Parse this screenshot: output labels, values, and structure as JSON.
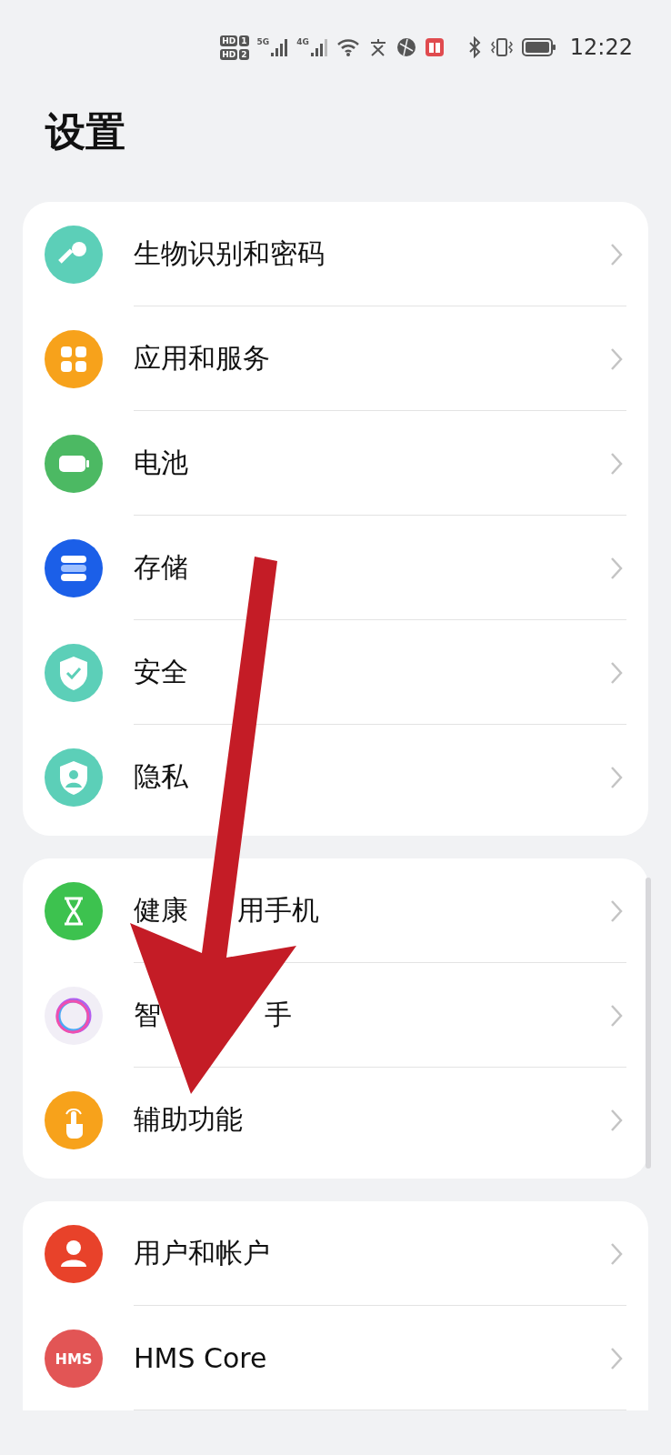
{
  "status_bar": {
    "sim_labels": [
      {
        "hd": "HD",
        "slot": "1"
      },
      {
        "hd": "HD",
        "slot": "2"
      }
    ],
    "networks": [
      "5G",
      "4G"
    ],
    "time": "12:22"
  },
  "title": "设置",
  "groups": [
    {
      "items": [
        {
          "color": "#5ccfb8",
          "label_parts": [
            "生物识别和密码"
          ]
        },
        {
          "color": "#f7a21b",
          "label_parts": [
            "应用和服务"
          ]
        },
        {
          "color": "#4cb963",
          "label_parts": [
            "电池"
          ]
        },
        {
          "color": "#1b5fe8",
          "label_parts": [
            "存储"
          ]
        },
        {
          "color": "#5ccfb8",
          "label_parts": [
            "安全"
          ]
        },
        {
          "color": "#5ccfb8",
          "label_parts": [
            "隐私"
          ]
        }
      ]
    },
    {
      "items": [
        {
          "color": "#3dc24f",
          "label_parts": [
            "健康",
            "用手机"
          ]
        },
        {
          "color": "#f1eef6",
          "label_parts": [
            "智",
            "手"
          ]
        },
        {
          "color": "#f7a21b",
          "label_parts": [
            "辅助功能"
          ]
        }
      ]
    },
    {
      "items": [
        {
          "color": "#e8422a",
          "label_parts": [
            "用户和帐户"
          ]
        },
        {
          "color": "#e25555",
          "icon_text": "HMS",
          "label_parts": [
            "HMS Core"
          ]
        }
      ]
    }
  ],
  "annotation": {
    "kind": "arrow"
  }
}
